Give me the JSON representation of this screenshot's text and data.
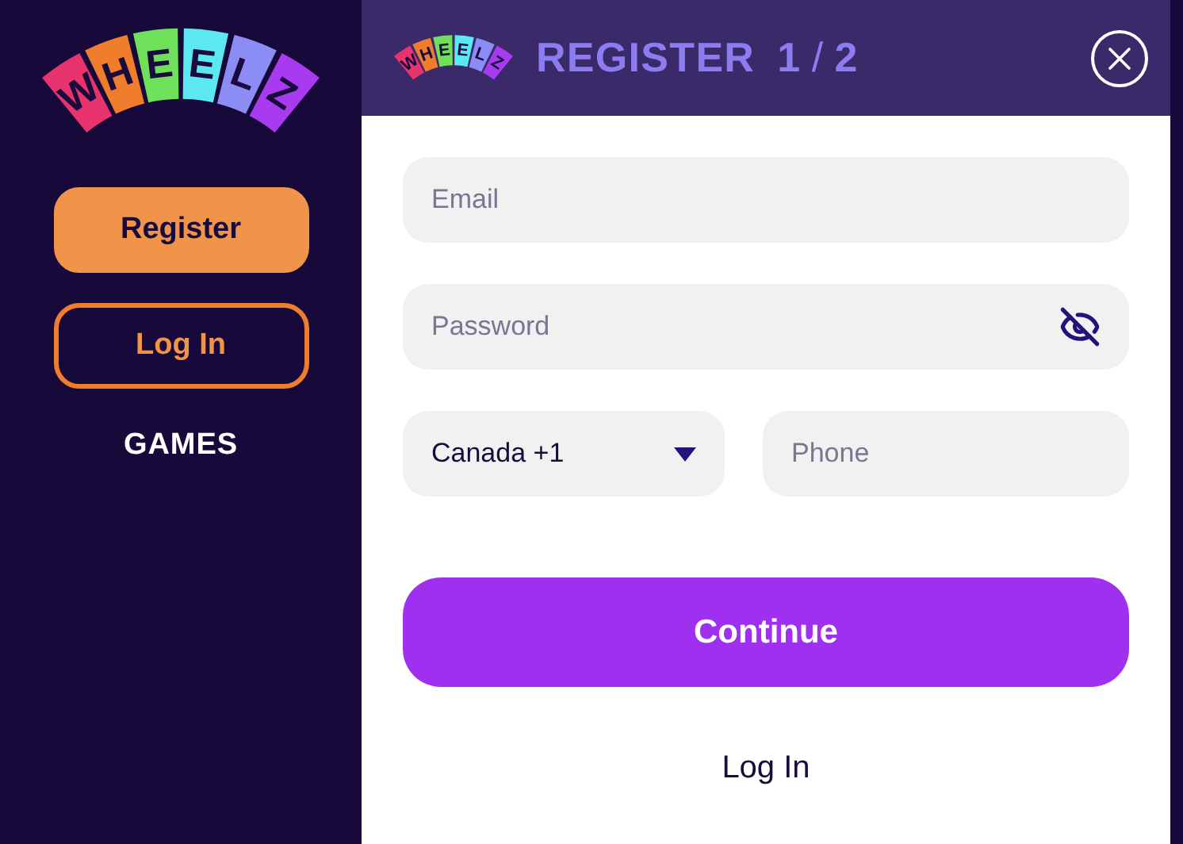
{
  "sidebar": {
    "logo": [
      {
        "letter": "W",
        "color": "#e8336f"
      },
      {
        "letter": "H",
        "color": "#f07d2c"
      },
      {
        "letter": "E",
        "color": "#6fe05a"
      },
      {
        "letter": "E",
        "color": "#5ce8f0"
      },
      {
        "letter": "L",
        "color": "#8c8cf5"
      },
      {
        "letter": "Z",
        "color": "#a83af0"
      }
    ],
    "buttons": [
      {
        "label": "Register",
        "kind": "filled"
      },
      {
        "label": "Log In",
        "kind": "outline"
      }
    ],
    "nav": [
      "GAMES"
    ]
  },
  "dialog": {
    "logo": [
      {
        "letter": "W",
        "color": "#e8336f"
      },
      {
        "letter": "H",
        "color": "#f07d2c"
      },
      {
        "letter": "E",
        "color": "#6fe05a"
      },
      {
        "letter": "E",
        "color": "#5ce8f0"
      },
      {
        "letter": "L",
        "color": "#8c8cf5"
      },
      {
        "letter": "Z",
        "color": "#a83af0"
      }
    ],
    "title": "REGISTER",
    "step": "1",
    "step_separator": "/",
    "step_total": "2",
    "email": {
      "placeholder": "Email"
    },
    "password": {
      "placeholder": "Password"
    },
    "country": {
      "value": "Canada +1"
    },
    "phone": {
      "placeholder": "Phone"
    },
    "submit": "Continue",
    "login_link": "Log In"
  }
}
